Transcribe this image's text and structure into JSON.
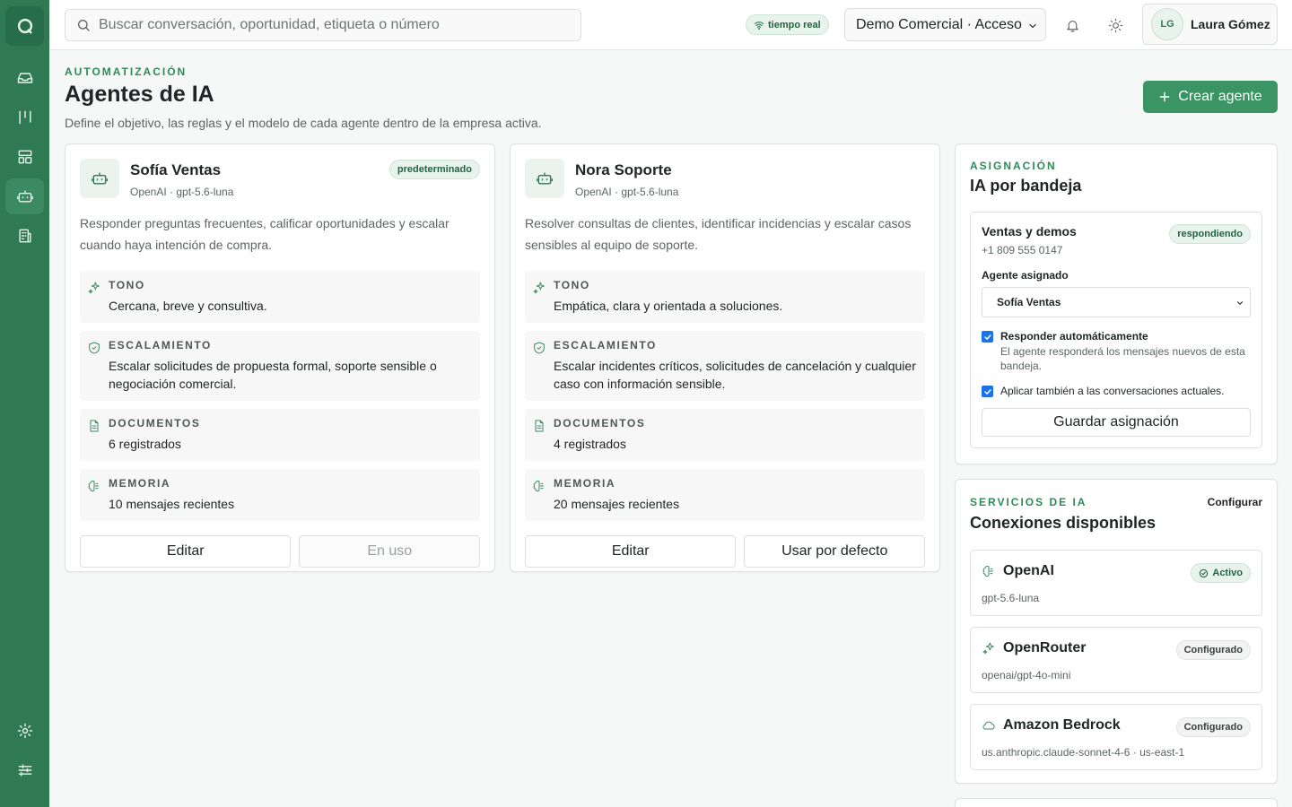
{
  "header": {
    "search_placeholder": "Buscar conversación, oportunidad, etiqueta o número",
    "live_label": "tiempo real",
    "company": "Demo Comercial · Acceso",
    "user": {
      "initials": "LG",
      "name": "Laura Gómez"
    }
  },
  "sidebar": {
    "items": [
      {
        "icon": "logo-icon"
      },
      {
        "icon": "inbox-icon"
      },
      {
        "icon": "pipeline-icon"
      },
      {
        "icon": "layout-icon"
      },
      {
        "icon": "bot-icon",
        "active": true
      },
      {
        "icon": "building-icon"
      },
      {
        "icon": "gear-icon"
      },
      {
        "icon": "sliders-icon"
      }
    ]
  },
  "page": {
    "eyebrow": "AUTOMATIZACIÓN",
    "title": "Agentes de IA",
    "subtitle": "Define el objetivo, las reglas y el modelo de cada agente dentro de la empresa activa.",
    "create_label": "Crear agente"
  },
  "agents": [
    {
      "name": "Sofía Ventas",
      "model": "OpenAI · gpt-5.6-luna",
      "badge": "predeterminado",
      "description": "Responder preguntas frecuentes, calificar oportunidades y escalar cuando haya intención de compra.",
      "fields": [
        {
          "label": "TONO",
          "value": "Cercana, breve y consultiva."
        },
        {
          "label": "ESCALAMIENTO",
          "value": "Escalar solicitudes de propuesta formal, soporte sensible o negociación comercial."
        },
        {
          "label": "DOCUMENTOS",
          "value": "6 registrados"
        },
        {
          "label": "MEMORIA",
          "value": "10 mensajes recientes"
        }
      ],
      "edit_label": "Editar",
      "default_label": "En uso"
    },
    {
      "name": "Nora Soporte",
      "model": "OpenAI · gpt-5.6-luna",
      "badge": "",
      "description": "Resolver consultas de clientes, identificar incidencias y escalar casos sensibles al equipo de soporte.",
      "fields": [
        {
          "label": "TONO",
          "value": "Empática, clara y orientada a soluciones."
        },
        {
          "label": "ESCALAMIENTO",
          "value": "Escalar incidentes críticos, solicitudes de cancelación y cualquier caso con información sensible."
        },
        {
          "label": "DOCUMENTOS",
          "value": "4 registrados"
        },
        {
          "label": "MEMORIA",
          "value": "20 mensajes recientes"
        }
      ],
      "edit_label": "Editar",
      "default_label": "Usar por defecto"
    }
  ],
  "assignment": {
    "eyebrow": "ASIGNACIÓN",
    "title": "IA por bandeja",
    "inbox_name": "Ventas y demos",
    "inbox_phone": "+1 809 555 0147",
    "status": "respondiendo",
    "agent_label": "Agente asignado",
    "agent_selected": "Sofía Ventas",
    "auto_title": "Responder automáticamente",
    "auto_help": "El agente responderá los mensajes nuevos de esta bandeja.",
    "auto_checked": true,
    "apply_label": "Aplicar también a las conversaciones actuales.",
    "apply_checked": true,
    "save_label": "Guardar asignación"
  },
  "services": {
    "eyebrow": "SERVICIOS DE IA",
    "title": "Conexiones disponibles",
    "configure_label": "Configurar",
    "items": [
      {
        "icon": "openai-icon",
        "name": "OpenAI",
        "model": "gpt-5.6-luna",
        "status": "Activo"
      },
      {
        "icon": "openrouter-icon",
        "name": "OpenRouter",
        "model": "openai/gpt-4o-mini",
        "status": "Configurado"
      },
      {
        "icon": "cloud-icon",
        "name": "Amazon Bedrock",
        "model": "us.anthropic.claude-sonnet-4-6 · us-east-1",
        "status": "Configurado"
      }
    ]
  },
  "colors": {
    "brand": "#2f7a53",
    "accent": "#3b9464",
    "background": "#f6f7f7"
  }
}
